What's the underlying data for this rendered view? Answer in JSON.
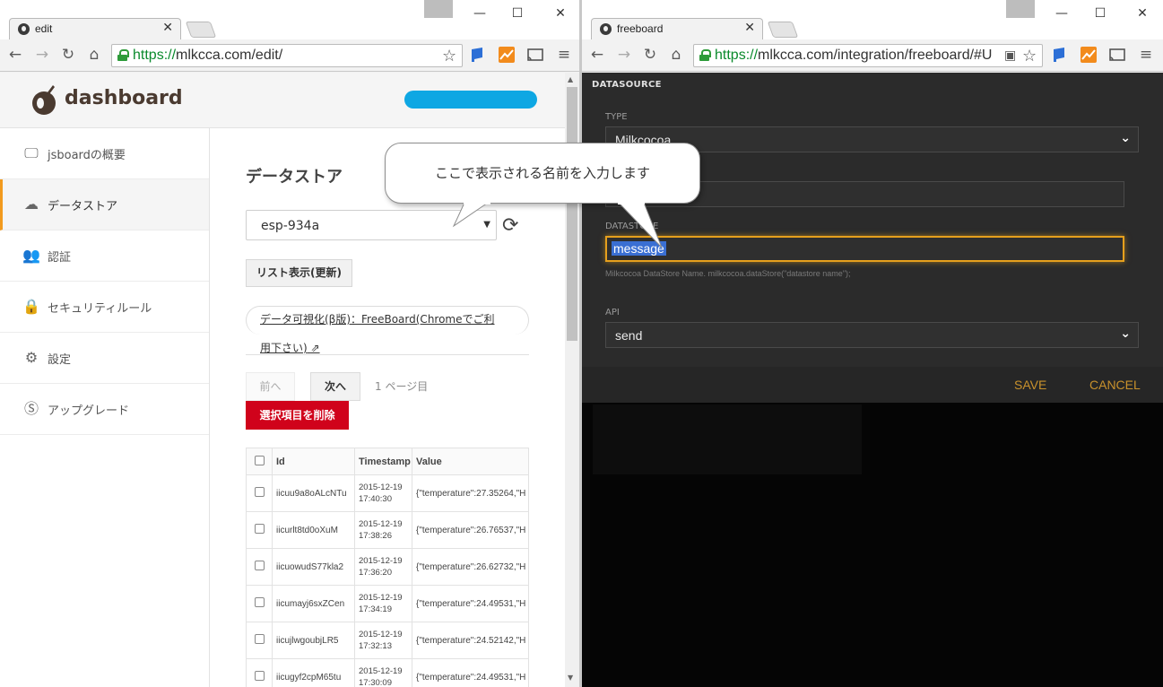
{
  "left_window": {
    "tab_title": "edit",
    "url_scheme": "https://",
    "url_rest": "mlkcca.com/edit/",
    "app_title": "dashboard",
    "sidebar": [
      {
        "label": "jsboardの概要",
        "icon": "monitor-icon"
      },
      {
        "label": "データストア",
        "icon": "cloud-icon"
      },
      {
        "label": "認証",
        "icon": "users-icon"
      },
      {
        "label": "セキュリティルール",
        "icon": "lock-icon"
      },
      {
        "label": "設定",
        "icon": "gear-icon"
      },
      {
        "label": "アップグレード",
        "icon": "dollar-icon"
      }
    ],
    "page_title": "データストア",
    "store_selected": "esp-934a",
    "list_button": "リスト表示(更新)",
    "viz_link_line1": "データ可視化(β版)：FreeBoard(Chromeでご利",
    "viz_link_line2": "用下さい)",
    "pager_prev": "前へ",
    "pager_next": "次へ",
    "pager_info": "1 ページ目",
    "delete_button": "選択項目を削除",
    "table": {
      "headers": [
        "Id",
        "Timestamp",
        "Value"
      ],
      "rows": [
        {
          "id": "iicuu9a8oALcNTu",
          "date": "2015-12-19",
          "time": "17:40:30",
          "value": "{\"temperature\":27.35264,\"H"
        },
        {
          "id": "iicurlt8td0oXuM",
          "date": "2015-12-19",
          "time": "17:38:26",
          "value": "{\"temperature\":26.76537,\"H"
        },
        {
          "id": "iicuowudS77kla2",
          "date": "2015-12-19",
          "time": "17:36:20",
          "value": "{\"temperature\":26.62732,\"H"
        },
        {
          "id": "iicumayj6sxZCen",
          "date": "2015-12-19",
          "time": "17:34:19",
          "value": "{\"temperature\":24.49531,\"H"
        },
        {
          "id": "iicujlwgoubjLR5",
          "date": "2015-12-19",
          "time": "17:32:13",
          "value": "{\"temperature\":24.52142,\"H"
        },
        {
          "id": "iicugyf2cpM65tu",
          "date": "2015-12-19",
          "time": "17:30:09",
          "value": "{\"temperature\":24.49531,\"H"
        }
      ]
    }
  },
  "callout_text": "ここで表示される名前を入力します",
  "right_window": {
    "tab_title": "freeboard",
    "url_scheme": "https://",
    "url_rest": "mlkcca.com/integration/freeboard/#U",
    "panel_title": "DATASOURCE",
    "type_label": "TYPE",
    "type_value": "Milkcocoa",
    "datastore_label": "DATASTORE",
    "datastore_value": "message",
    "datastore_hint": "Milkcocoa DataStore Name. milkcocoa.dataStore(\"datastore name\");",
    "api_label": "API",
    "api_value": "send",
    "save_label": "SAVE",
    "cancel_label": "CANCEL"
  },
  "colors": {
    "accent_orange": "#f29a1e",
    "delete_red": "#d0021b",
    "freeboard_gold": "#c8912c",
    "focus_border": "#e6a01d"
  }
}
